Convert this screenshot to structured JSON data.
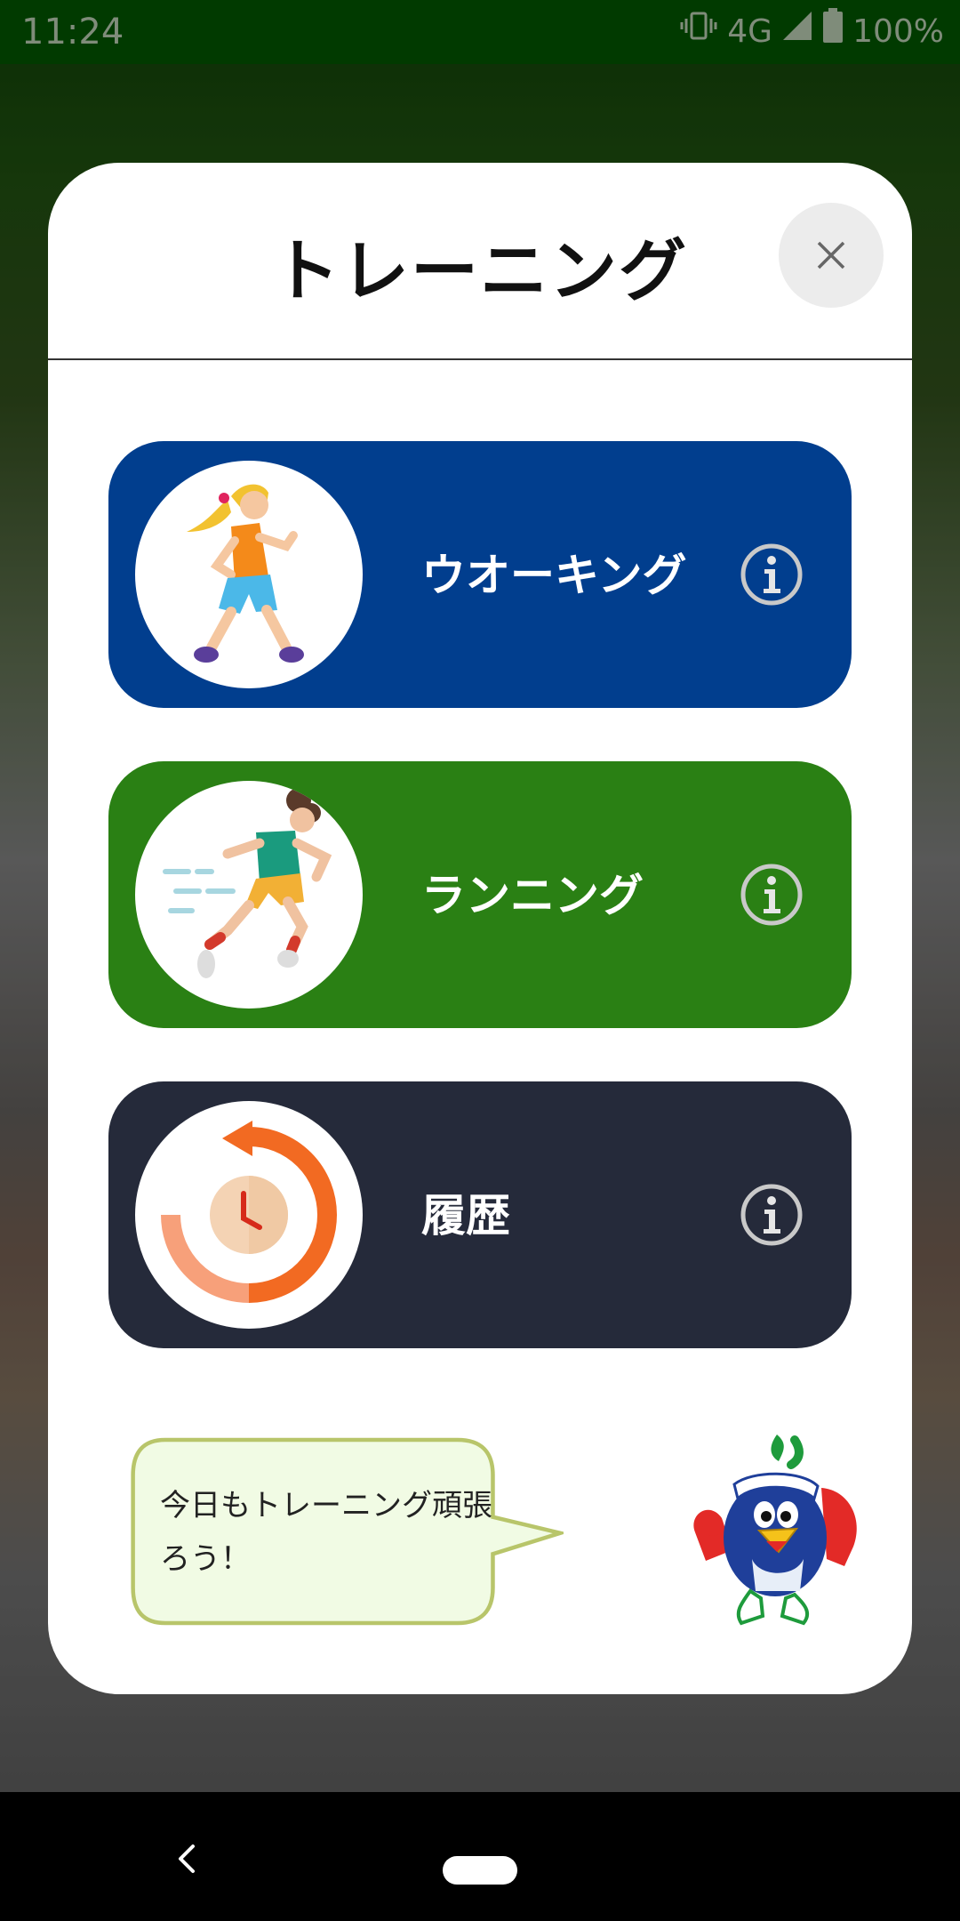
{
  "status_bar": {
    "time": "11:24",
    "network": "4G",
    "battery": "100%"
  },
  "modal": {
    "title": "トレーニング",
    "close_icon": "close-icon"
  },
  "menu": [
    {
      "label": "ウオーキング",
      "color": "#013e8e",
      "icon": "walking-person-icon",
      "info_icon": "info-icon"
    },
    {
      "label": "ランニング",
      "color": "#2a8014",
      "icon": "running-person-icon",
      "info_icon": "info-icon"
    },
    {
      "label": "履歴",
      "color": "#252a3a",
      "icon": "history-clock-icon",
      "info_icon": "info-icon"
    }
  ],
  "speech": {
    "line1": "今日もトレーニング頑張",
    "line2": "ろう！"
  },
  "mascot": "mascot-bird-icon",
  "nav": {
    "back_icon": "back-chevron-icon",
    "home_icon": "home-pill-icon"
  }
}
